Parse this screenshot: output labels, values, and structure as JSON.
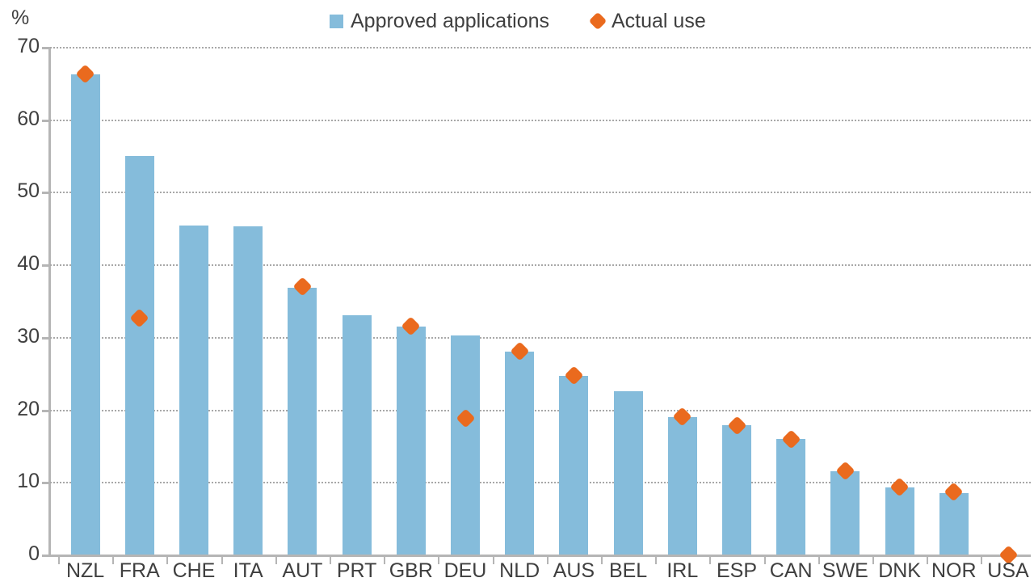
{
  "axis_unit_label": "%",
  "legend": {
    "items": [
      {
        "label": "Approved applications",
        "marker": "square",
        "color": "#85bcdb"
      },
      {
        "label": "Actual use",
        "marker": "diamond",
        "color": "#ea6a1e"
      }
    ]
  },
  "colors": {
    "bar": "#85bcdb",
    "marker": "#ea6a1e",
    "axis": "#b5b5b5",
    "gridline": "#a8a8a8",
    "text": "#3f3f3f",
    "background": "#ffffff"
  },
  "chart_data": {
    "type": "bar",
    "title": "",
    "subtitle": "",
    "xlabel": "",
    "ylabel": "%",
    "ylim": [
      0,
      70
    ],
    "ytick_values": [
      0,
      10,
      20,
      30,
      40,
      50,
      60,
      70
    ],
    "ytick_labels": [
      "0",
      "10",
      "20",
      "30",
      "40",
      "50",
      "60",
      "70"
    ],
    "grid": true,
    "grid_axis": "y",
    "legend_position": "top-center",
    "categories": [
      "NZL",
      "FRA",
      "CHE",
      "ITA",
      "AUT",
      "PRT",
      "GBR",
      "DEU",
      "NLD",
      "AUS",
      "BEL",
      "IRL",
      "ESP",
      "CAN",
      "SWE",
      "DNK",
      "NOR",
      "USA"
    ],
    "series": [
      {
        "name": "Approved applications",
        "type": "bar",
        "color": "#85bcdb",
        "values": [
          66.2,
          55.0,
          45.4,
          45.2,
          36.8,
          33.0,
          31.4,
          30.2,
          28.0,
          24.6,
          22.5,
          18.9,
          17.8,
          15.9,
          11.5,
          9.2,
          8.5,
          null
        ]
      },
      {
        "name": "Actual use",
        "type": "scatter",
        "marker": "diamond",
        "color": "#ea6a1e",
        "values": [
          66.3,
          32.6,
          null,
          null,
          36.9,
          null,
          31.5,
          18.8,
          28.0,
          24.7,
          null,
          19.0,
          17.8,
          15.9,
          11.5,
          9.3,
          8.6,
          0.0
        ]
      }
    ]
  }
}
